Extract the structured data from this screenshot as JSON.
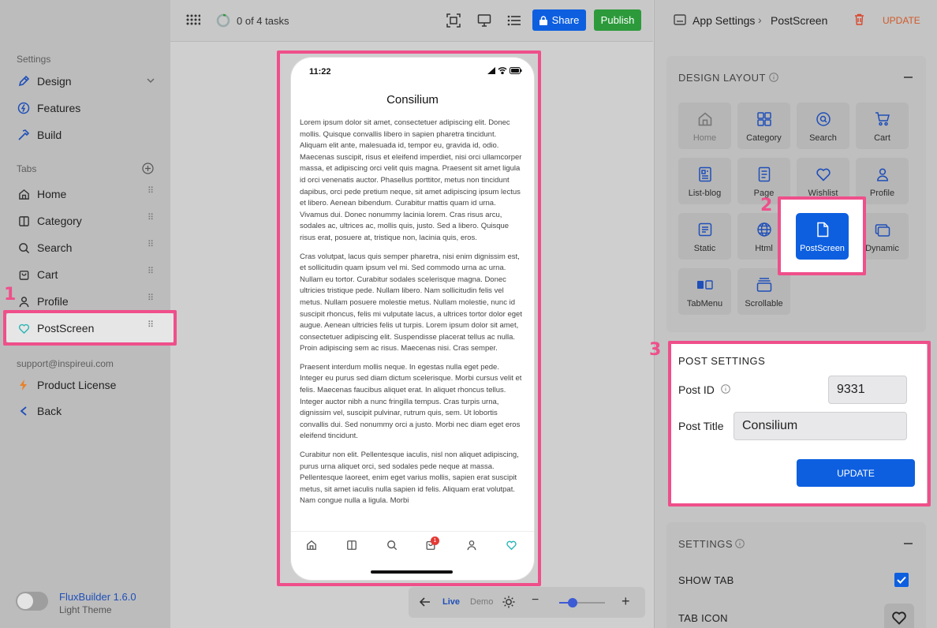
{
  "sidebar": {
    "settings_label": "Settings",
    "design": "Design",
    "features": "Features",
    "build": "Build",
    "tabs_label": "Tabs",
    "tabs": [
      "Home",
      "Category",
      "Search",
      "Cart",
      "Profile",
      "PostScreen"
    ],
    "email": "support@inspireui.com",
    "license": "Product License",
    "back": "Back",
    "version": "FluxBuilder 1.6.0",
    "theme": "Light Theme"
  },
  "topbar": {
    "tasks": "0 of 4 tasks",
    "share": "Share",
    "publish": "Publish"
  },
  "phone": {
    "time": "11:22",
    "title": "Consilium",
    "paragraphs": [
      "Lorem ipsum dolor sit amet, consectetuer adipiscing elit. Donec mollis. Quisque convallis libero in sapien pharetra tincidunt. Aliquam elit ante, malesuada id, tempor eu, gravida id, odio. Maecenas suscipit, risus et eleifend imperdiet, nisi orci ullamcorper massa, et adipiscing orci velit quis magna. Praesent sit amet ligula id orci venenatis auctor. Phasellus porttitor, metus non tincidunt dapibus, orci pede pretium neque, sit amet adipiscing ipsum lectus et libero. Aenean bibendum. Curabitur mattis quam id urna. Vivamus dui. Donec nonummy lacinia lorem. Cras risus arcu, sodales ac, ultrices ac, mollis quis, justo. Sed a libero. Quisque risus erat, posuere at, tristique non, lacinia quis, eros.",
      "Cras volutpat, lacus quis semper pharetra, nisi enim dignissim est, et sollicitudin quam ipsum vel mi. Sed commodo urna ac urna. Nullam eu tortor. Curabitur sodales scelerisque magna. Donec ultricies tristique pede. Nullam libero. Nam sollicitudin felis vel metus. Nullam posuere molestie metus. Nullam molestie, nunc id suscipit rhoncus, felis mi vulputate lacus, a ultrices tortor dolor eget augue. Aenean ultricies felis ut turpis. Lorem ipsum dolor sit amet, consectetuer adipiscing elit. Suspendisse placerat tellus ac nulla. Proin adipiscing sem ac risus. Maecenas nisi. Cras semper.",
      "Praesent interdum mollis neque. In egestas nulla eget pede. Integer eu purus sed diam dictum scelerisque. Morbi cursus velit et felis. Maecenas faucibus aliquet erat. In aliquet rhoncus tellus. Integer auctor nibh a nunc fringilla tempus. Cras turpis urna, dignissim vel, suscipit pulvinar, rutrum quis, sem. Ut lobortis convallis dui. Sed nonummy orci a justo. Morbi nec diam eget eros eleifend tincidunt.",
      "Curabitur non elit. Pellentesque iaculis, nisl non aliquet adipiscing, purus urna aliquet orci, sed sodales pede neque at massa. Pellentesque laoreet, enim eget varius mollis, sapien erat suscipit metus, sit amet iaculis nulla sapien id felis. Aliquam erat volutpat. Nam congue nulla a ligula. Morbi"
    ],
    "cart_badge": "1"
  },
  "bottom_toolbar": {
    "live": "Live",
    "demo": "Demo",
    "zoom_level": 0.3
  },
  "right": {
    "breadcrumb_root": "App Settings",
    "breadcrumb_current": "PostScreen",
    "update": "UPDATE",
    "design_layout": "DESIGN LAYOUT",
    "tiles": [
      "Home",
      "Category",
      "Search",
      "Cart",
      "List-blog",
      "Page",
      "Wishlist",
      "Profile",
      "Static",
      "Html",
      "PostScreen",
      "Dynamic",
      "TabMenu",
      "Scrollable"
    ],
    "post_settings": "POST SETTINGS",
    "post_id_label": "Post ID",
    "post_id_value": "9331",
    "post_title_label": "Post Title",
    "post_title_value": "Consilium",
    "post_update": "UPDATE",
    "settings": "SETTINGS",
    "show_tab": "SHOW TAB",
    "tab_icon": "TAB ICON"
  },
  "markers": [
    "1",
    "2",
    "3"
  ],
  "colors": {
    "accent": "#0d5fe0",
    "publish": "#2c9a3b",
    "highlight": "#ef4f8a",
    "delete": "#d9482e",
    "active_tab": "#2ab5b5"
  }
}
